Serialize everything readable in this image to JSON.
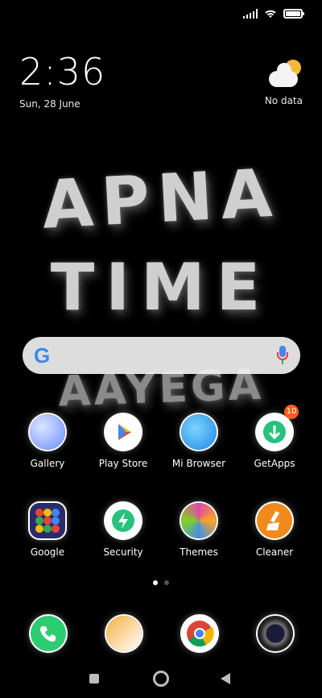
{
  "status_bar": {
    "signal_icon": "signal-icon",
    "wifi_icon": "wifi-icon",
    "battery_icon": "battery-icon"
  },
  "clock_widget": {
    "time": "2:36",
    "date": "Sun, 28 June"
  },
  "weather_widget": {
    "icon": "partly-cloudy-icon",
    "text": "No data"
  },
  "wallpaper": {
    "line1": "APNA",
    "line2": "TIME",
    "line3": "AAYEGA"
  },
  "search_bar": {
    "logo": "G",
    "mic_icon": "mic-icon"
  },
  "apps_row1": [
    {
      "label": "Gallery",
      "icon": "gallery-icon",
      "color": "#6c8cff"
    },
    {
      "label": "Play Store",
      "icon": "play-store-icon",
      "color": "#34a853"
    },
    {
      "label": "Mi Browser",
      "icon": "mi-browser-icon",
      "color": "#1e88e5"
    },
    {
      "label": "GetApps",
      "icon": "getapps-icon",
      "color": "#27c27d",
      "badge": "10"
    }
  ],
  "apps_row2": [
    {
      "label": "Google",
      "icon": "google-folder-icon",
      "color": "#3a3a9e"
    },
    {
      "label": "Security",
      "icon": "security-icon",
      "color": "#27c27d"
    },
    {
      "label": "Themes",
      "icon": "themes-icon",
      "color": "#e04ba4"
    },
    {
      "label": "Cleaner",
      "icon": "cleaner-icon",
      "color": "#f08a1c"
    }
  ],
  "dock": [
    {
      "icon": "phone-icon",
      "color": "#2ecc71"
    },
    {
      "icon": "notes-icon",
      "color": "#f5b041"
    },
    {
      "icon": "chrome-icon",
      "color": "#db4437"
    },
    {
      "icon": "camera-icon",
      "color": "#2a2a2a"
    }
  ],
  "nav": {
    "recent_icon": "recent-apps-icon",
    "home_icon": "home-icon",
    "back_icon": "back-icon"
  }
}
